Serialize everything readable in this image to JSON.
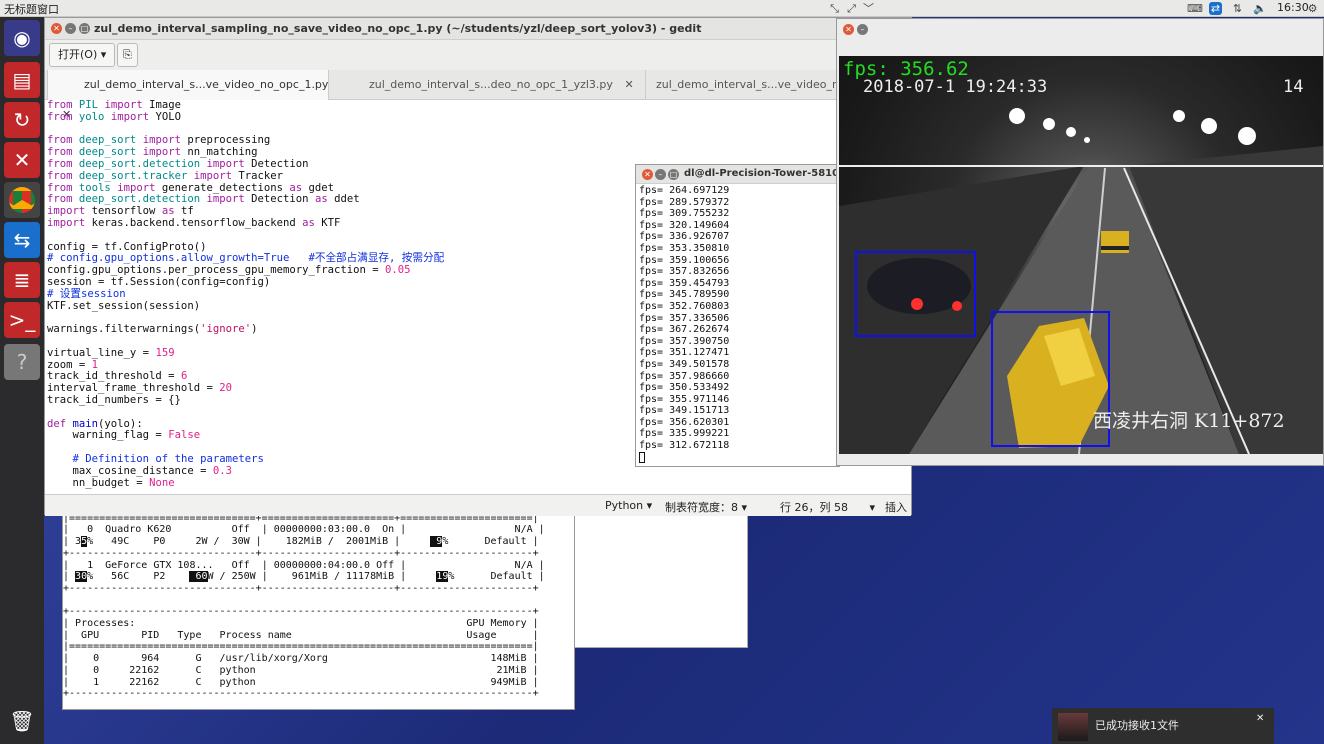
{
  "top_panel": {
    "title": "无标题窗口",
    "clock": "16:30"
  },
  "launcher": {
    "items": [
      "ubuntu-dash-icon",
      "files-icon",
      "update-icon",
      "system-tools-icon",
      "chrome-icon",
      "teamviewer-icon",
      "text-editor-icon",
      "terminal-icon",
      "unknown-app-icon",
      "trash-icon"
    ]
  },
  "gedit": {
    "title": "zul_demo_interval_sampling_no_save_video_no_opc_1.py (~/students/yzl/deep_sort_yolov3) - gedit",
    "open_label": "打开(O)",
    "tabs": [
      "zul_demo_interval_s...ve_video_no_opc_1.py",
      "zul_demo_interval_s...deo_no_opc_1_yzl3.py",
      "zul_demo_interval_s...ve_video_no_opc_1"
    ],
    "status": {
      "language": "Python",
      "tab_width": "制表符宽度：8",
      "position": "行 26，列 58",
      "mode": "插入"
    }
  },
  "fps_terminal": {
    "title": "dl@dl-Precision-Tower-5810: ~",
    "values": [
      "fps= 264.697129",
      "fps= 289.579372",
      "fps= 309.755232",
      "fps= 320.149604",
      "fps= 336.926707",
      "fps= 353.350810",
      "fps= 359.100656",
      "fps= 357.832656",
      "fps= 359.454793",
      "fps= 345.789590",
      "fps= 352.760803",
      "fps= 357.336506",
      "fps= 367.262674",
      "fps= 357.390750",
      "fps= 351.127471",
      "fps= 349.501578",
      "fps= 357.986660",
      "fps= 350.533492",
      "fps= 355.971146",
      "fps= 349.151713",
      "fps= 356.620301",
      "fps= 335.999221",
      "fps= 312.672118"
    ]
  },
  "video": {
    "fps": "fps: 356.62",
    "datetime": "2018-07-1  19:24:33",
    "count": "14",
    "location": "西凌井右洞  K11+872"
  },
  "nvidia": {
    "gpu0_name": "Quadro K620",
    "gpu1_name": "GeForce GTX 108...",
    "processes_label": "Processes:",
    "gpu_memory_label": "GPU Memory",
    "usage_label": "Usage"
  },
  "notification": {
    "text": "已成功接收1文件"
  }
}
